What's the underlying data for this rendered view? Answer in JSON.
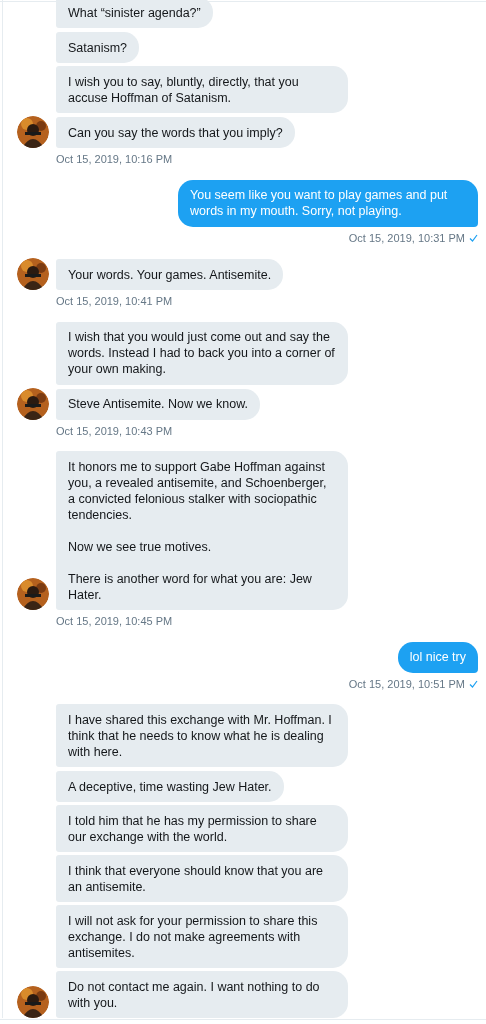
{
  "conversation": [
    {
      "kind": "incoming",
      "messages": [
        "What “sinister agenda?”",
        "Satanism?",
        "I wish you to say, bluntly, directly, that you accuse Hoffman of Satanism.",
        "Can you say the words that you imply?"
      ],
      "time": "Oct 15, 2019, 10:16 PM"
    },
    {
      "kind": "outgoing",
      "messages": [
        "You seem like you want to play games and put words in my mouth. Sorry, not playing."
      ],
      "time": "Oct 15, 2019, 10:31 PM",
      "read": true
    },
    {
      "kind": "incoming",
      "messages": [
        "Your words. Your games. Antisemite."
      ],
      "time": "Oct 15, 2019, 10:41 PM"
    },
    {
      "kind": "incoming",
      "messages": [
        "I wish that you would just come out and say the words. Instead I had to back you into a corner of your own making.",
        "Steve Antisemite. Now we know."
      ],
      "time": "Oct 15, 2019, 10:43 PM"
    },
    {
      "kind": "incoming",
      "messages": [
        "It honors me to support Gabe Hoffman against you, a revealed antisemite, and Schoenberger, a convicted felonious stalker with sociopathic tendencies.\n\nNow we see true motives.\n\nThere is another word for what you are: Jew Hater."
      ],
      "time": "Oct 15, 2019, 10:45 PM"
    },
    {
      "kind": "outgoing",
      "messages": [
        "lol nice try"
      ],
      "time": "Oct 15, 2019, 10:51 PM",
      "read": true
    },
    {
      "kind": "incoming",
      "messages": [
        "I have shared this exchange with Mr. Hoffman. I think that he needs to know what he is dealing with here.",
        "A deceptive, time wasting Jew Hater.",
        "I told him that he has my permission to share our exchange with the world.",
        "I think that everyone should know that you are an antisemite.",
        "I will not ask for your permission to share this exchange. I do not make agreements with antisemites.",
        "Do not contact me again. I want nothing to do with you."
      ]
    }
  ]
}
